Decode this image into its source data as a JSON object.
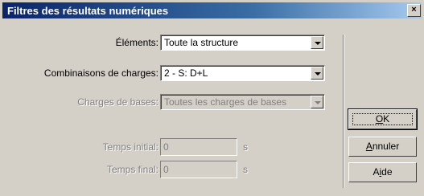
{
  "window": {
    "title": "Filtres des résultats numériques",
    "close_glyph": "×"
  },
  "fields": {
    "elements": {
      "label": "Éléments:",
      "value": "Toute la structure"
    },
    "combinaisons": {
      "label": "Combinaisons de charges:",
      "value": "2 - S: D+L"
    },
    "charges_bases": {
      "label": "Charges de bases:",
      "value": "Toutes les charges de bases"
    },
    "temps_initial": {
      "label": "Temps initial:",
      "value": "0",
      "unit": "s"
    },
    "temps_final": {
      "label": "Temps final:",
      "value": "0",
      "unit": "s"
    }
  },
  "buttons": {
    "ok": {
      "mnemonic": "O",
      "rest": "K"
    },
    "annuler": {
      "mnemonic": "A",
      "rest": "nnuler"
    },
    "aide": {
      "prefix": "A",
      "mnemonic": "i",
      "rest": "de"
    }
  }
}
